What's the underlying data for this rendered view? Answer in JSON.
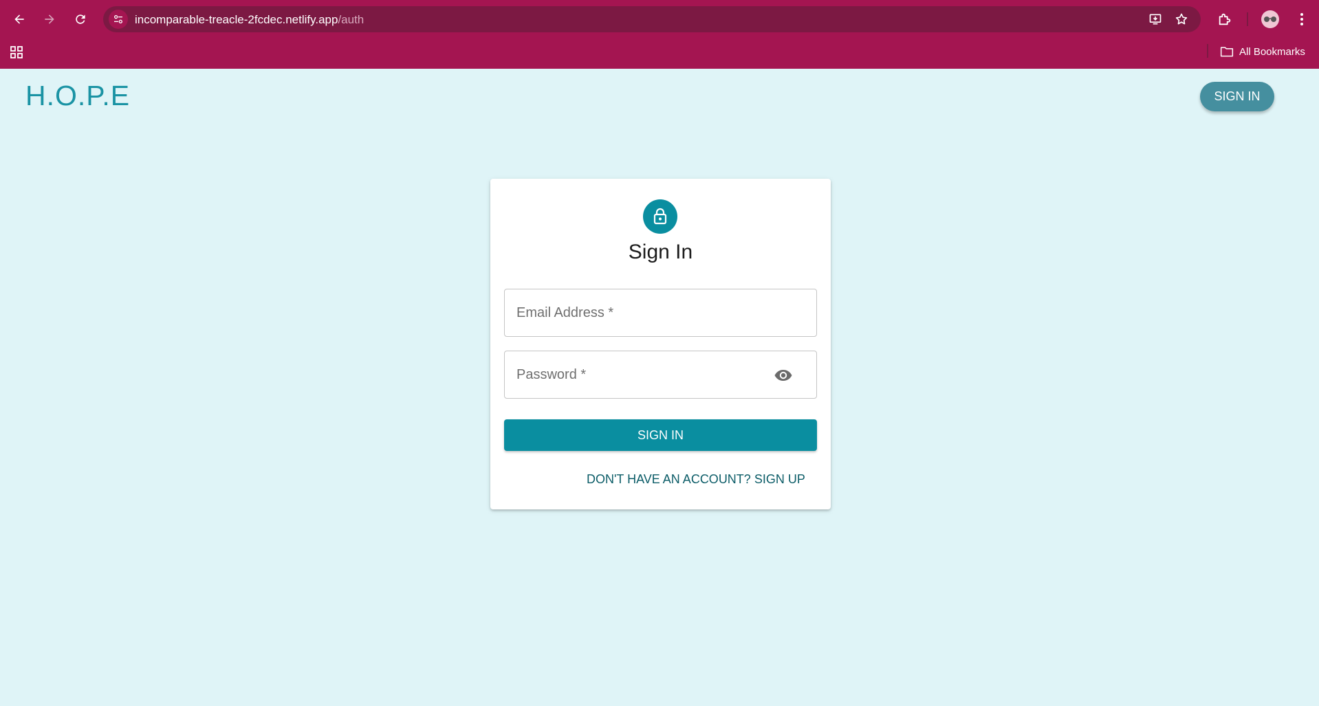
{
  "browser": {
    "url_host": "incomparable-treacle-2fcdec.netlify.app",
    "url_path": "/auth",
    "bookmarks_label": "All Bookmarks",
    "colors": {
      "frame": "#a41551",
      "omnibox": "#7c1943"
    },
    "icons": [
      "back-arrow-icon",
      "forward-arrow-icon",
      "reload-icon",
      "site-info-icon",
      "install-app-icon",
      "star-icon",
      "extensions-icon",
      "avatar",
      "more-vert-icon",
      "apps-grid-icon",
      "folder-icon"
    ]
  },
  "header": {
    "logo": "H.O.P.E",
    "signin_label": "SIGN IN"
  },
  "card": {
    "icon": "lock-icon",
    "title": "Sign In",
    "email_placeholder": "Email Address *",
    "email_value": "",
    "password_placeholder": "Password *",
    "password_value": "",
    "password_toggle_icon": "eye-icon",
    "submit_label": "SIGN IN",
    "signup_link": "DON'T HAVE AN ACCOUNT? SIGN UP"
  },
  "colors": {
    "page_bg": "#dff4f7",
    "accent": "#0a8ea0",
    "header_button": "#458f9f",
    "logo": "#1a93a4",
    "link": "#0b5c67"
  }
}
